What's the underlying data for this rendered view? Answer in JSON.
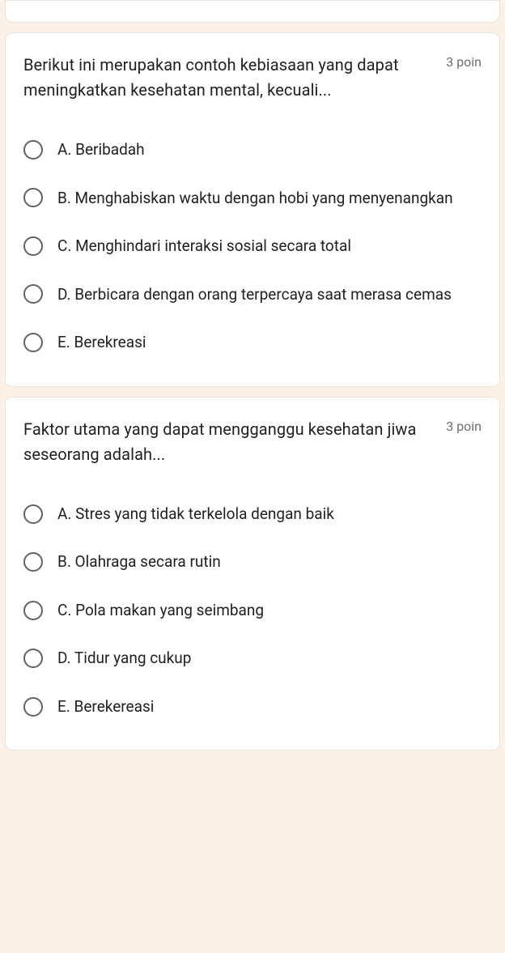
{
  "questions": [
    {
      "text": "Berikut ini merupakan contoh kebiasaan yang dapat meningkatkan kesehatan mental, kecuali...",
      "points": "3 poin",
      "options": [
        "A. Beribadah",
        "B. Menghabiskan waktu dengan hobi yang menyenangkan",
        "C. Menghindari interaksi sosial secara total",
        "D. Berbicara dengan orang terpercaya saat merasa cemas",
        "E. Berekreasi"
      ]
    },
    {
      "text": "Faktor utama yang dapat mengganggu kesehatan jiwa seseorang adalah...",
      "points": "3 poin",
      "options": [
        "A. Stres yang tidak terkelola dengan baik",
        "B. Olahraga secara rutin",
        "C. Pola makan yang seimbang",
        "D. Tidur yang cukup",
        "E. Berekereasi"
      ]
    }
  ]
}
